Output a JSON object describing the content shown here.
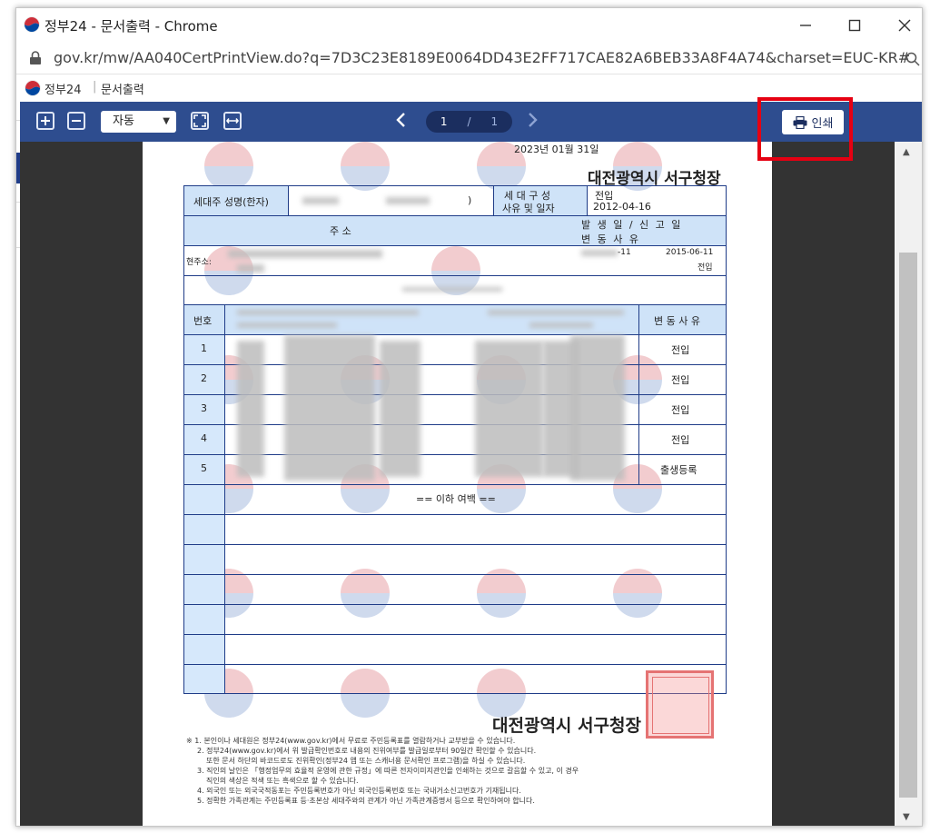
{
  "window": {
    "title": "정부24 - 문서출력 - Chrome",
    "url": "gov.kr/mw/AA040CertPrintView.do?q=7D3C23E8189E0064DD43E2FF717CAE82A6BEB33A8F4A74&charset=EUC-KR#"
  },
  "site": {
    "name": "정부24",
    "page": "문서출력"
  },
  "toolbar": {
    "zoom_value": "자동",
    "page_current": "1",
    "page_sep": "/",
    "page_total": "1",
    "print_label": "인쇄"
  },
  "doc": {
    "date": "2023년 01월 31일",
    "issuer_top": "대전광역시 서구청장",
    "issuer_bottom": "대전광역시 서구청장",
    "head_name_label": "세대주 성명(한자)",
    "head_name_close": ")",
    "composition_label_1": "세 대 구 성",
    "composition_label_2": "사유 및 일자",
    "composition_reason": "전입",
    "composition_date": "2012-04-16",
    "address_header": "주                    소",
    "date_header_1": "발 생 일 / 신 고 일",
    "date_header_2": "변      동      사      유",
    "current_address_label": "현주소:",
    "addr_date_partial": "-11",
    "addr_report_date": "2015-06-11",
    "addr_reason": "전입",
    "col_no": "번호",
    "col_reason": "변 동 사 유",
    "rows": [
      {
        "no": "1",
        "reason": "전입"
      },
      {
        "no": "2",
        "reason": "전입"
      },
      {
        "no": "3",
        "reason": "전입"
      },
      {
        "no": "4",
        "reason": "전입"
      },
      {
        "no": "5",
        "reason": "출생등록"
      }
    ],
    "end_marker": "== 이하 여백 ==",
    "notes": [
      "※ 1. 본인이나 세대원은 정부24(www.gov.kr)에서 무료로 주민등록표를 열람하거나 교부받을 수 있습니다.",
      "2. 정부24(www.gov.kr)에서 위 발급확인번호로 내용의 진위여부를 발급일로부터 90일간 확인할 수 있습니다.",
      "또한 문서 하단의 바코드로도 진위확인(정부24 앱 또는 스캐너용 문서확인 프로그램)을 하실 수 있습니다.",
      "3. 직인의 날인은 「행정업무의 효율적 운영에 관한 규정」에 따른 전자이미지관인을 인쇄하는 것으로 갈음할 수 있고, 이 경우",
      "직인의 색상은 적색 또는 흑색으로 할 수 있습니다.",
      "4. 외국인 또는 외국국적동포는 주민등록번호가 아닌 외국인등록번호 또는 국내거소신고번호가 기재됩니다.",
      "5. 정확한 가족관계는 주민등록표 등·초본상 세대주와의 관계가 아닌 가족관계증명서 등으로 확인하여야 합니다."
    ]
  }
}
